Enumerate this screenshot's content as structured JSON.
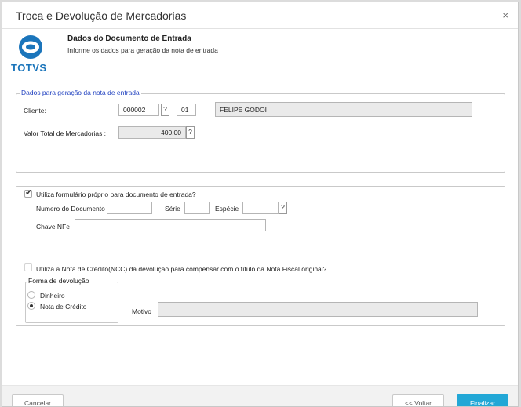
{
  "dialog": {
    "title": "Troca e Devolução de Mercadorias",
    "close": "×"
  },
  "brand": {
    "logo_icon": "totvs-logo-icon",
    "logo_text": "TOTVS",
    "color": "#1b75bb"
  },
  "header": {
    "title": "Dados do Documento de Entrada",
    "subtitle": "Informe os dados para geração da nota de entrada"
  },
  "section1": {
    "legend": "Dados para geração da nota de entrada",
    "cliente_label": "Cliente:",
    "cliente_code": "000002",
    "cliente_loja": "01",
    "cliente_name": "FELIPE GODOI",
    "valor_label": "Valor Total de Mercadorias :",
    "valor": "400,00",
    "lookup": "?"
  },
  "section2": {
    "formulario_label": "Utiliza formulário próprio para documento de entrada?",
    "formulario_checked": true,
    "numero_label": "Numero do Documento",
    "numero_value": "",
    "serie_label": "Série",
    "serie_value": "",
    "especie_label": "Espécie",
    "especie_value": "",
    "chave_label": "Chave NFe",
    "chave_value": "",
    "ncc_label": "Utiliza a Nota de Crédito(NCC) da devolução para compensar com o título da Nota Fiscal original?",
    "ncc_checked": false,
    "forma_legend": "Forma de devolução",
    "opt_dinheiro": "Dinheiro",
    "opt_nota": "Nota de Crédito",
    "selected_option": "Nota de Crédito",
    "motivo_label": "Motivo",
    "motivo_value": ""
  },
  "footer": {
    "cancel": "Cancelar",
    "back": "<< Voltar",
    "finish": "Finalizar",
    "accent": "#22a7d6"
  }
}
